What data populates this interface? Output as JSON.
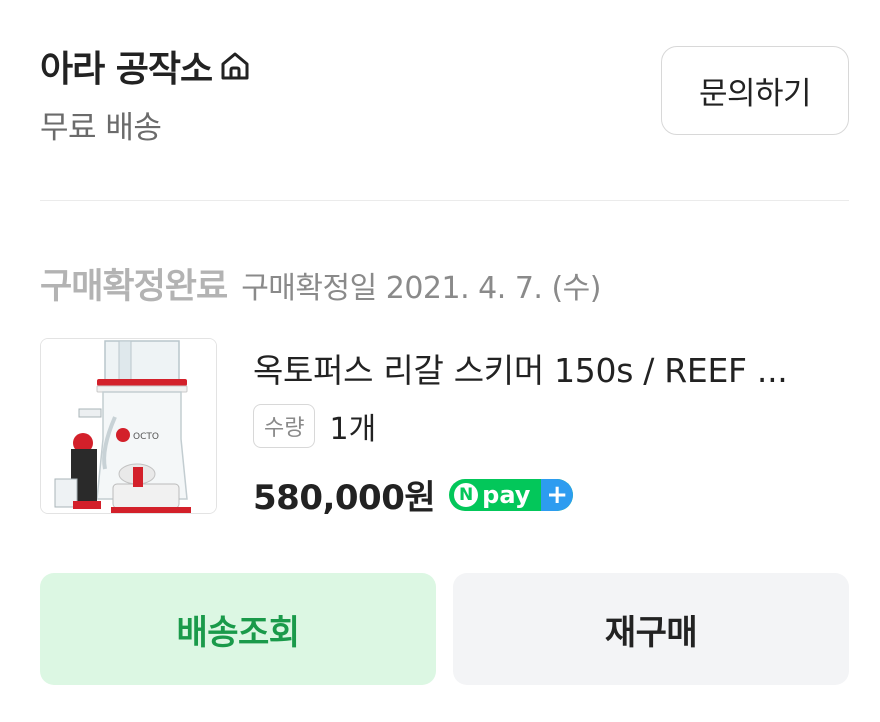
{
  "store": {
    "name": "아라 공작소",
    "home_icon": "home-icon",
    "shipping": "무료 배송",
    "inquiry_label": "문의하기"
  },
  "order": {
    "status": "구매확정완료",
    "confirm_date": "구매확정일 2021. 4. 7. (수)"
  },
  "product": {
    "name": "옥토퍼스 리갈 스키머 150s / REEF ...",
    "qty_label": "수량",
    "qty_value": "1개",
    "price": "580,000원",
    "pay_badge": {
      "n": "N",
      "text": "pay",
      "plus": "+"
    }
  },
  "actions": {
    "track_label": "배송조회",
    "rebuy_label": "재구매"
  },
  "colors": {
    "accent_green": "#1a9a4a",
    "track_bg": "#dcf7e3",
    "rebuy_bg": "#f3f4f6",
    "npay_green": "#03c75a",
    "npay_blue": "#2d9cf0"
  }
}
